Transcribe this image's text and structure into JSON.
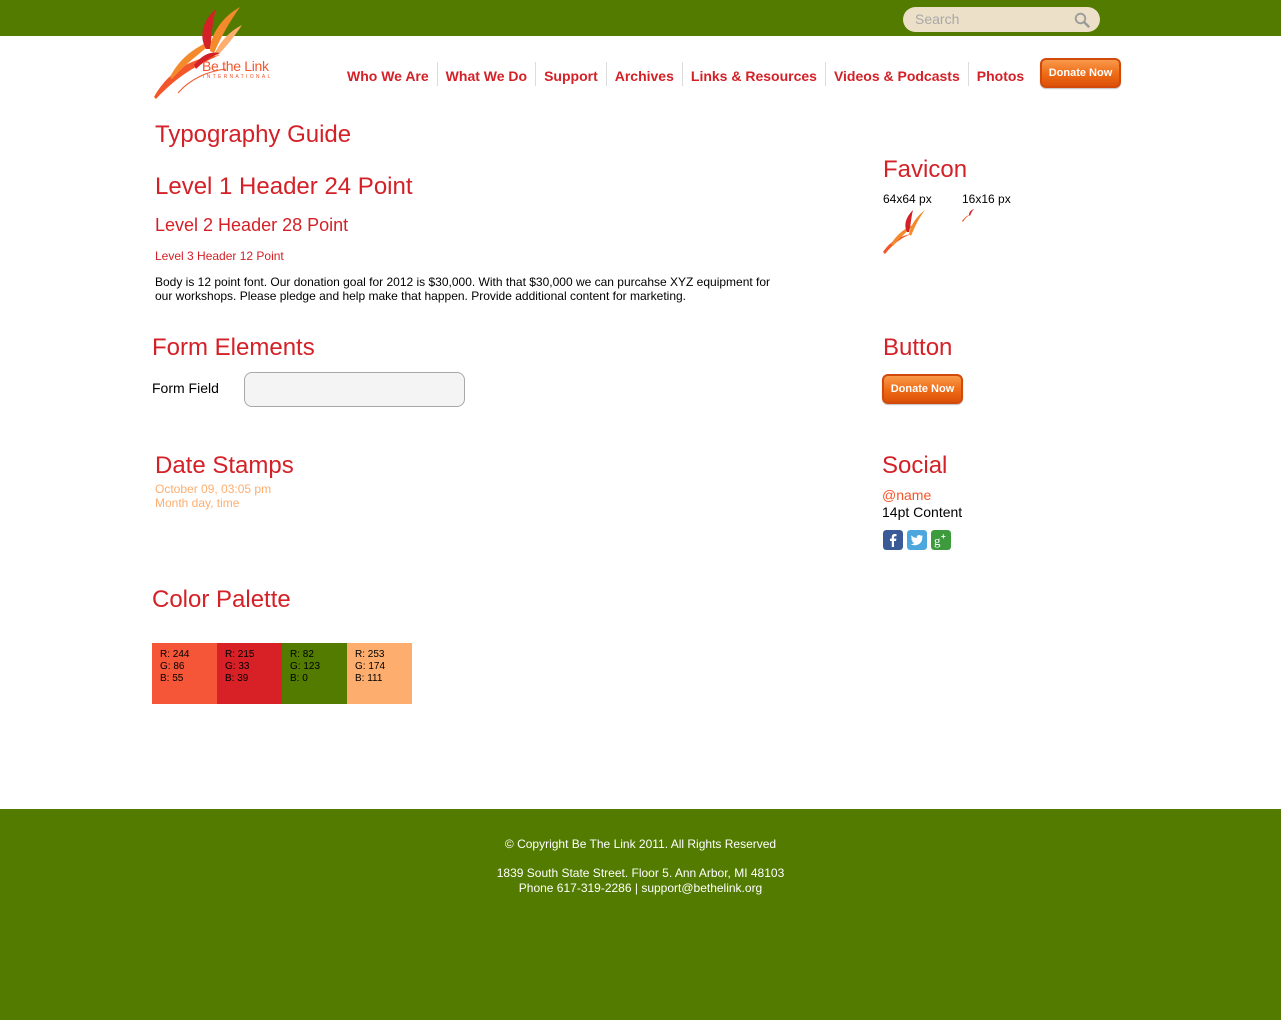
{
  "colors": {
    "topbar": "#527b00",
    "red": "#d32127",
    "orange": "#f4562b",
    "peach": "#fdae6f",
    "green": "#527b00"
  },
  "header": {
    "search_placeholder": "Search",
    "logo_text": "Be the Link",
    "logo_sub": "INTERNATIONAL",
    "nav": [
      "Who We Are",
      "What We Do",
      "Support",
      "Archives",
      "Links & Resources",
      "Videos & Podcasts",
      "Photos"
    ],
    "donate_label": "Donate Now"
  },
  "typography": {
    "title": "Typography Guide",
    "h1": "Level 1 Header 24 Point",
    "h2": "Level 2 Header 28 Point",
    "h3": "Level 3 Header 12 Point",
    "body_line1": "Body is 12 point font. Our donation goal for 2012 is $30,000. With that $30,000 we can purcahse XYZ equipment for",
    "body_line2": "our workshops. Please pledge and help make that happen. Provide additional content for marketing."
  },
  "favicon": {
    "title": "Favicon",
    "size_large": "64x64 px",
    "size_small": "16x16 px"
  },
  "form": {
    "title": "Form Elements",
    "field_label": "Form Field",
    "field_value": ""
  },
  "button": {
    "title": "Button",
    "label": "Donate Now"
  },
  "dates": {
    "title": "Date Stamps",
    "example": "October 09, 03:05 pm",
    "format": "Month day, time"
  },
  "social": {
    "title": "Social",
    "handle": "@name",
    "content": "14pt Content",
    "icons": [
      "facebook-icon",
      "twitter-icon",
      "google-plus-icon"
    ]
  },
  "palette": {
    "title": "Color Palette",
    "swatches": [
      {
        "hex": "#f45637",
        "r": "R: 244",
        "g": "G: 86",
        "b": "B: 55"
      },
      {
        "hex": "#d72127",
        "r": "R: 215",
        "g": "G: 33",
        "b": "B: 39"
      },
      {
        "hex": "#527b00",
        "r": "R: 82",
        "g": "G: 123",
        "b": "B: 0"
      },
      {
        "hex": "#fdae6f",
        "r": "R: 253",
        "g": "G: 174",
        "b": "B: 111"
      }
    ]
  },
  "footer": {
    "copyright": "© Copyright Be The Link 2011. All Rights Reserved",
    "address": "1839 South State Street. Floor 5. Ann Arbor, MI 48103",
    "contact": "Phone 617-319-2286 | support@bethelink.org"
  }
}
